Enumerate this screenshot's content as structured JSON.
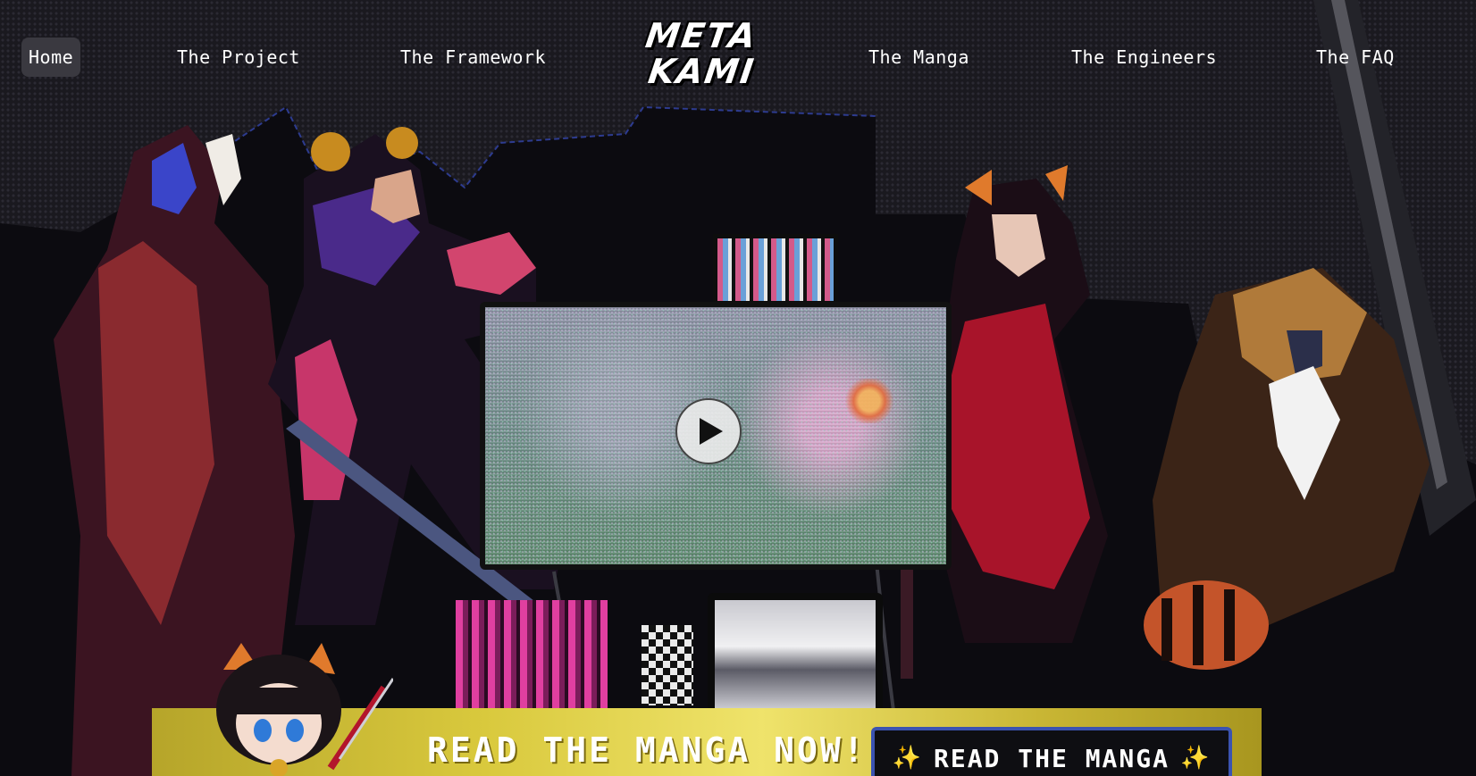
{
  "nav": {
    "items": [
      {
        "label": "Home",
        "active": true
      },
      {
        "label": "The Project"
      },
      {
        "label": "The Framework"
      },
      {
        "label": "The Manga"
      },
      {
        "label": "The Engineers"
      },
      {
        "label": "The FAQ"
      }
    ]
  },
  "logo": {
    "line1": "META",
    "line2": "KAMI"
  },
  "promo": {
    "title": "READ THE MANGA NOW!",
    "button_label": "READ THE MANGA",
    "sparkle": "✨"
  },
  "colors": {
    "background": "#17161b",
    "promo_gold": "#d9c93d",
    "button_border": "#3b53b0",
    "accent_pink": "#e03fa0",
    "accent_red": "#b3152c"
  },
  "icons": {
    "play": "play-icon",
    "sparkle": "sparkle-icon"
  }
}
